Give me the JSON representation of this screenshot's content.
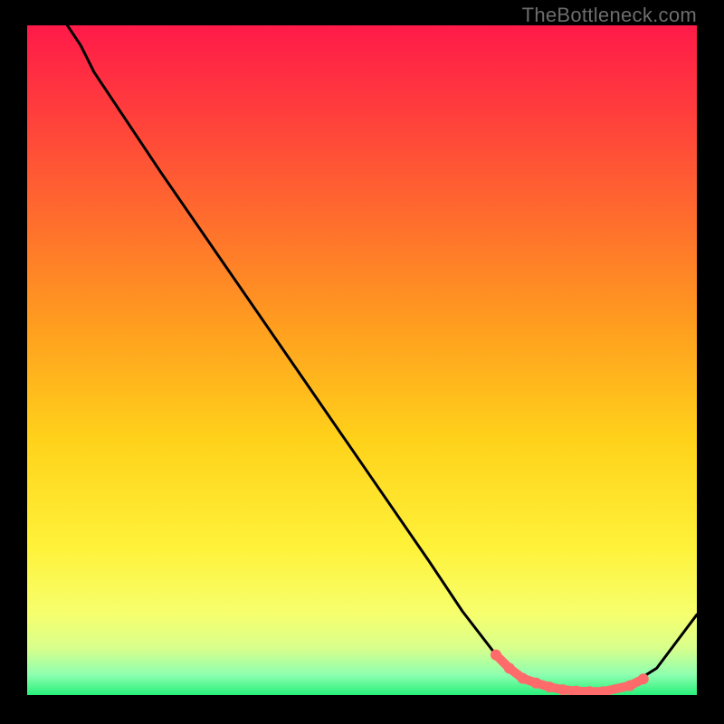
{
  "watermark": "TheBottleneck.com",
  "colors": {
    "background": "#000000",
    "curve": "#000000",
    "marker": "#ff6b6b",
    "gradient_top": "#ff1a49",
    "gradient_bottom": "#28f07a"
  },
  "chart_data": {
    "type": "line",
    "title": "",
    "xlabel": "",
    "ylabel": "",
    "xlim": [
      0,
      100
    ],
    "ylim": [
      0,
      100
    ],
    "series": [
      {
        "name": "curve",
        "x": [
          6,
          8,
          10,
          14,
          20,
          30,
          40,
          50,
          60,
          65,
          70,
          74,
          78,
          82,
          86,
          90,
          94,
          100
        ],
        "y": [
          100,
          97,
          93,
          87,
          78,
          63.5,
          49,
          34.5,
          20,
          12.5,
          6,
          2.5,
          1,
          0.5,
          0.5,
          1.5,
          4,
          12
        ]
      }
    ],
    "markers": {
      "name": "highlight",
      "x": [
        70,
        72,
        74,
        76,
        78,
        80,
        82,
        84,
        86,
        90,
        92
      ],
      "y": [
        6,
        4,
        2.5,
        1.8,
        1.2,
        0.8,
        0.6,
        0.5,
        0.5,
        1.4,
        2.4
      ]
    }
  }
}
